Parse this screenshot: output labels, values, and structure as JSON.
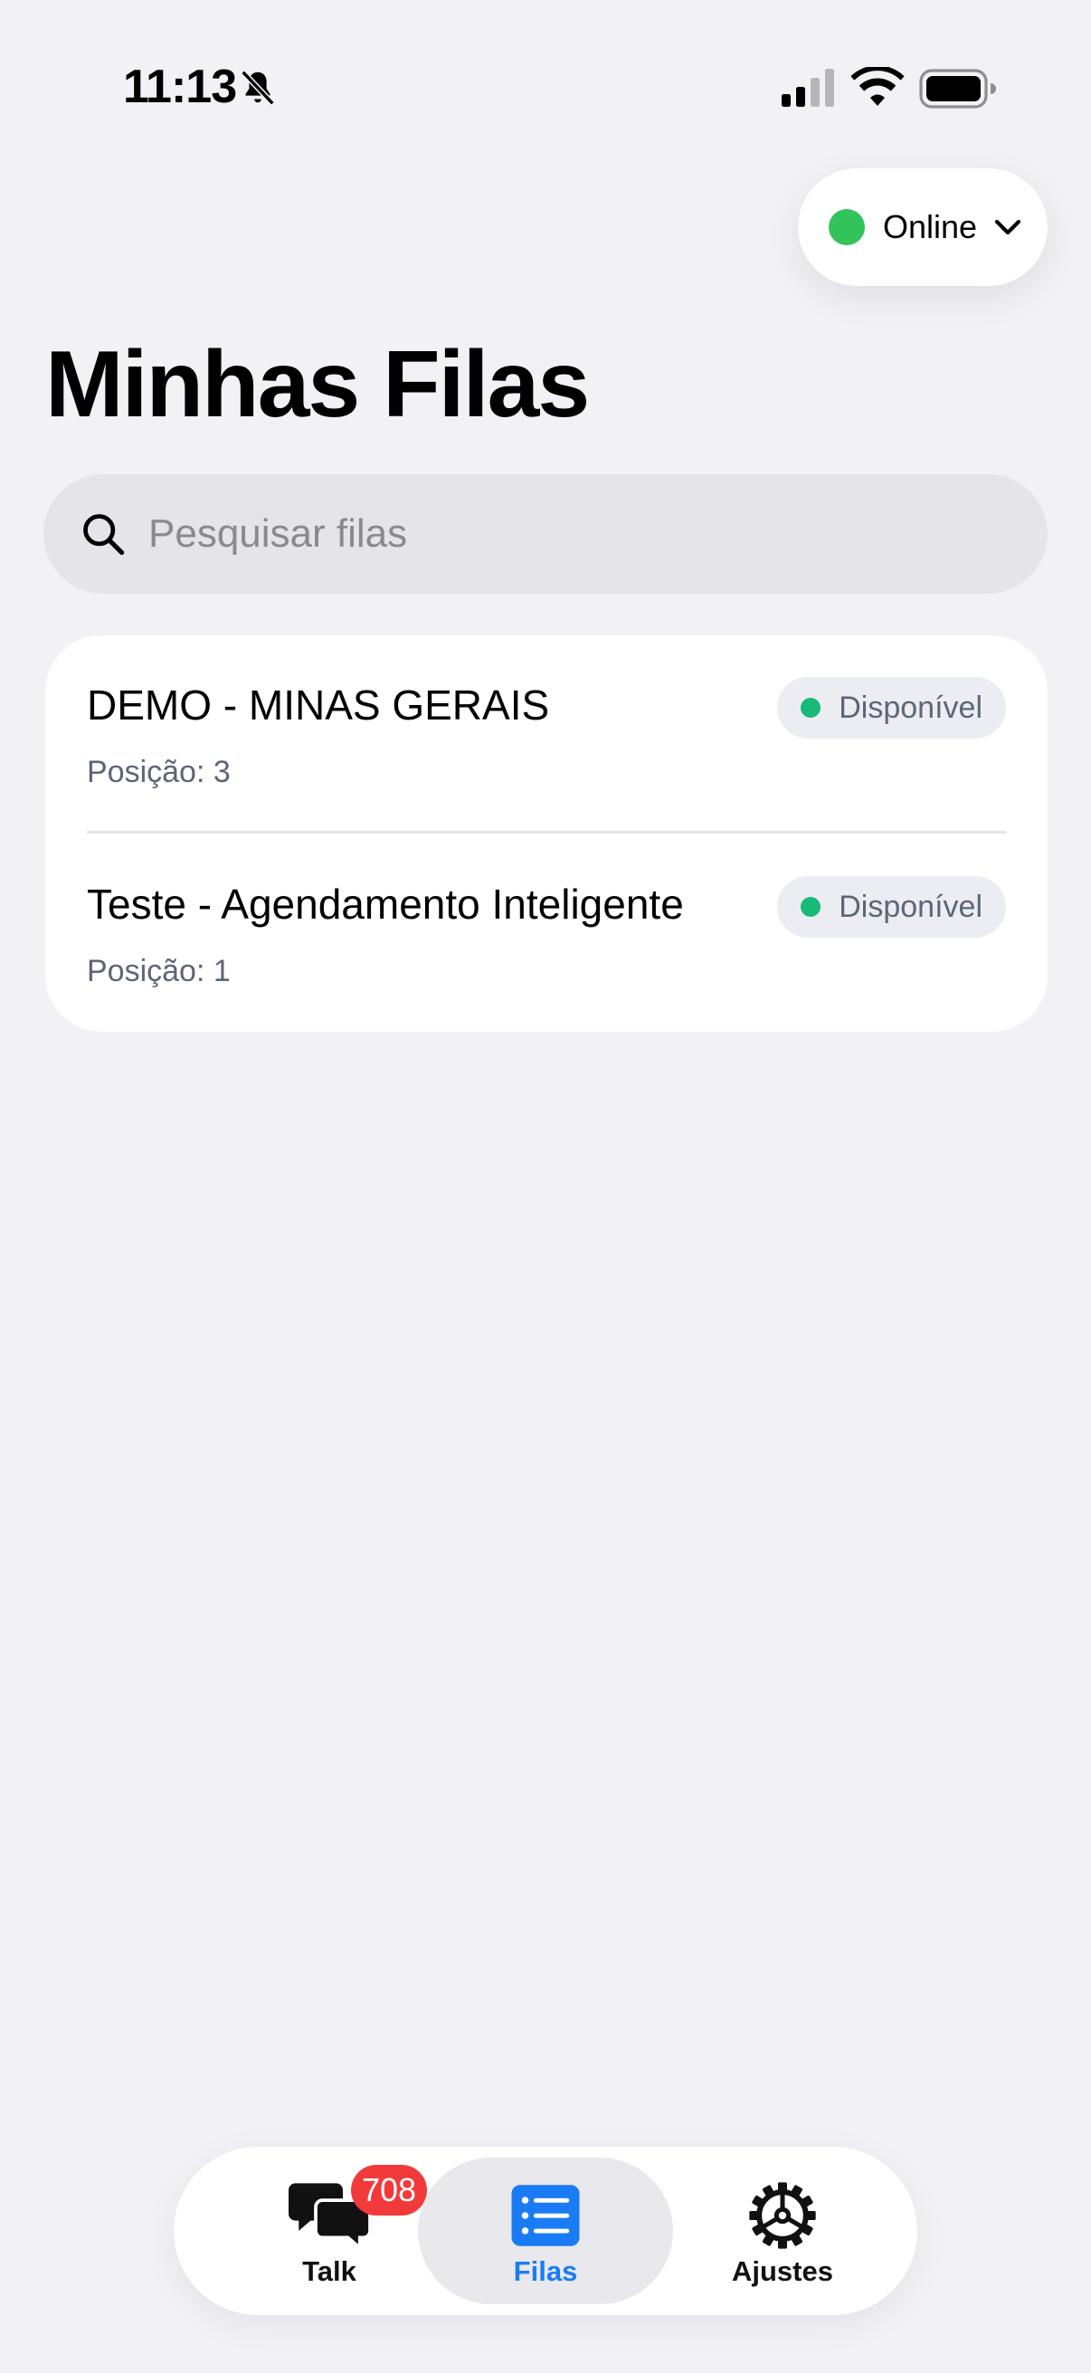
{
  "status_bar": {
    "time": "11:13"
  },
  "presence": {
    "label": "Online",
    "color": "#32c35a"
  },
  "page": {
    "title": "Minhas Filas"
  },
  "search": {
    "placeholder": "Pesquisar filas"
  },
  "queues": [
    {
      "name": "DEMO - MINAS GERAIS",
      "position": "Posição: 3",
      "status": "Disponível"
    },
    {
      "name": "Teste - Agendamento Inteligente",
      "position": "Posição: 1",
      "status": "Disponível"
    }
  ],
  "tab_bar": {
    "tabs": [
      {
        "label": "Talk",
        "icon": "chat-bubbles-icon",
        "badge": "708"
      },
      {
        "label": "Filas",
        "icon": "list-icon",
        "active": true
      },
      {
        "label": "Ajustes",
        "icon": "gear-icon"
      }
    ]
  },
  "colors": {
    "accent": "#1a7cf5",
    "available": "#19b978",
    "badge": "#f23a3a"
  }
}
